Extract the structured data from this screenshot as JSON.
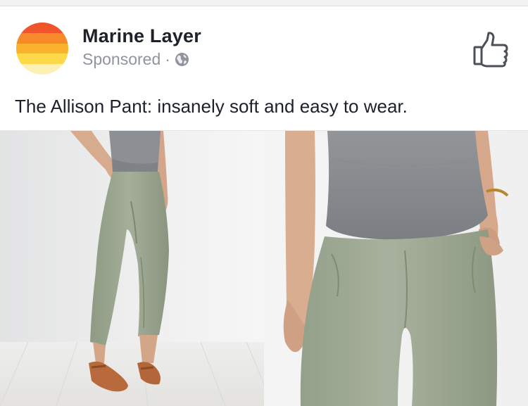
{
  "post": {
    "page_name": "Marine Layer",
    "sponsored_label": "Sponsored",
    "separator": "·",
    "caption": "The Allison Pant: insanely soft and easy to wear.",
    "icons": [
      "globe-icon",
      "like-icon"
    ]
  },
  "avatar": {
    "bands": [
      "#f0542a",
      "#f7892a",
      "#fbb22d",
      "#fdd94a",
      "#fdf0b6"
    ]
  },
  "images": {
    "left": "product-photo-full-length",
    "right": "product-photo-closeup"
  }
}
